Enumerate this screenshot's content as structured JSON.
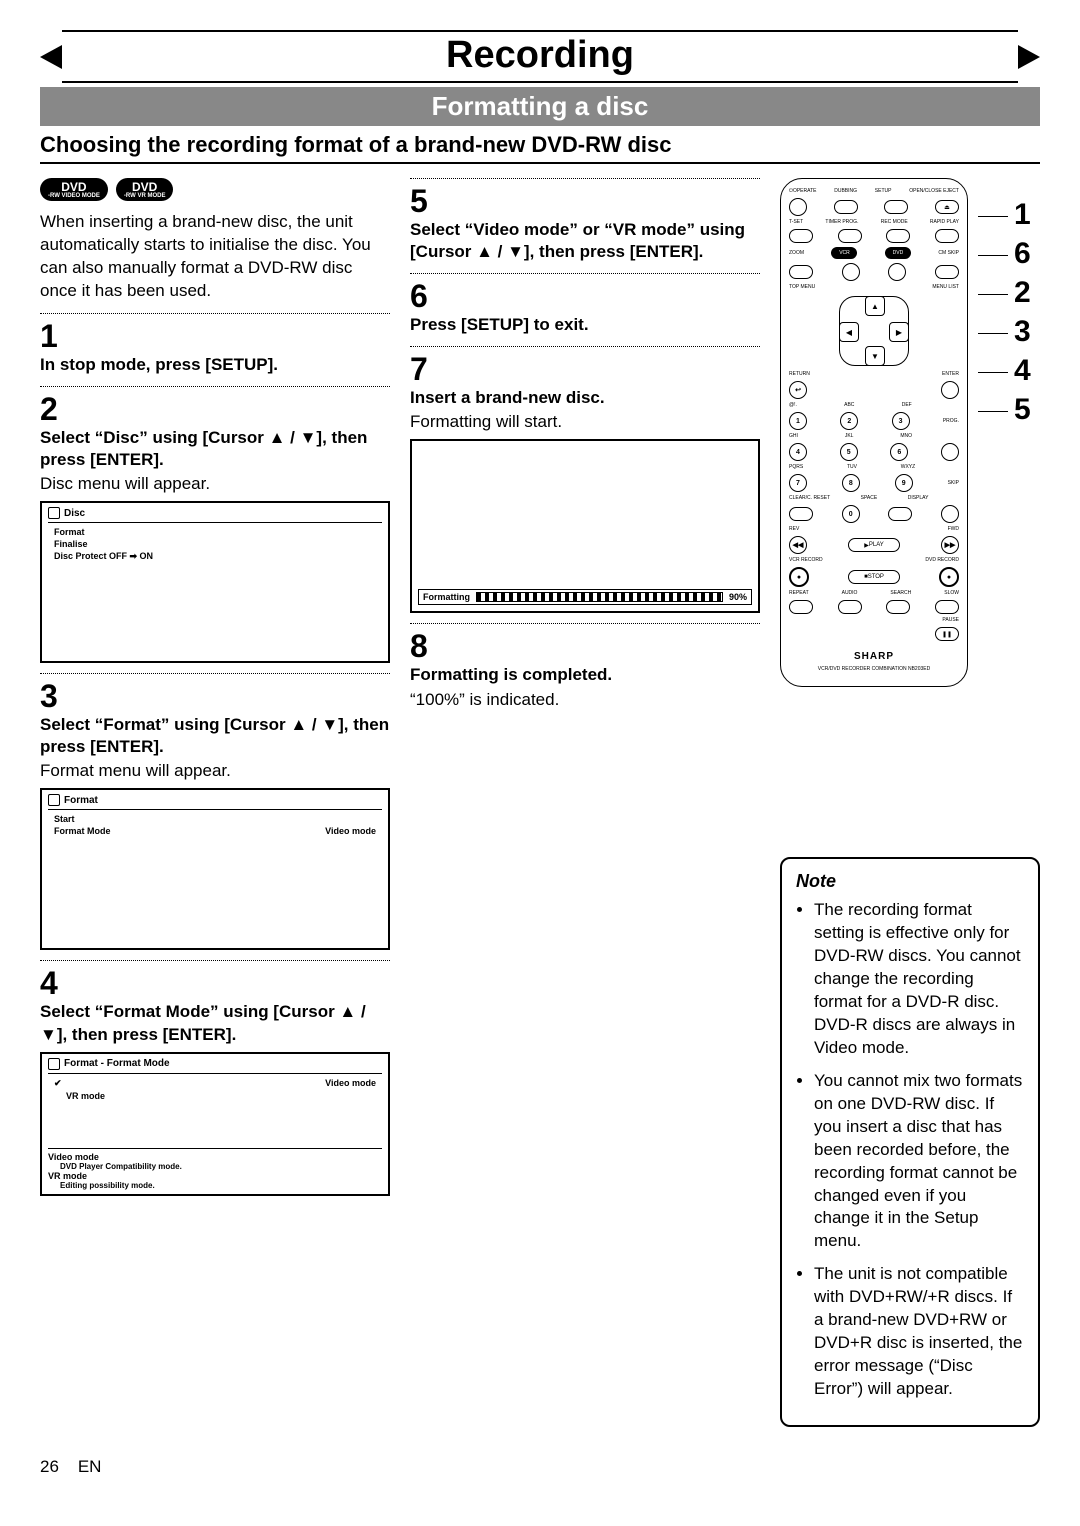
{
  "header": {
    "title": "Recording",
    "subtitle": "Formatting a disc",
    "section": "Choosing the recording format of a brand-new DVD-RW disc"
  },
  "badges": {
    "a": "DVD",
    "a_sub": "-RW VIDEO MODE",
    "b": "DVD",
    "b_sub": "-RW VR MODE"
  },
  "intro": "When inserting a brand-new disc, the unit automatically starts to initialise the disc. You can also manually format a DVD-RW disc once it has been used.",
  "step1": {
    "num": "1",
    "bold": "In stop mode, press [SETUP]."
  },
  "step2": {
    "num": "2",
    "bold": "Select “Disc” using [Cursor ▲ / ▼], then press [ENTER].",
    "plain": "Disc menu will appear.",
    "screen": {
      "title": "Disc",
      "rows": [
        "Format",
        "Finalise",
        "Disc Protect OFF ➡ ON"
      ]
    }
  },
  "step3": {
    "num": "3",
    "bold": "Select “Format” using [Cursor ▲ / ▼], then press [ENTER].",
    "plain": "Format menu will appear.",
    "screen": {
      "title": "Format",
      "rows": [
        [
          "Start",
          ""
        ],
        [
          "Format Mode",
          "Video mode"
        ]
      ]
    }
  },
  "step4": {
    "num": "4",
    "bold": "Select “Format Mode” using [Cursor ▲ / ▼], then press [ENTER].",
    "screen": {
      "title": "Format - Format Mode",
      "rows": [
        "Video mode",
        "VR mode"
      ],
      "hints": [
        [
          "Video mode",
          "DVD Player Compatibility mode."
        ],
        [
          "VR mode",
          "Editing possibility mode."
        ]
      ]
    }
  },
  "step5": {
    "num": "5",
    "bold": "Select “Video mode” or “VR mode” using [Cursor ▲ / ▼], then press [ENTER]."
  },
  "step6": {
    "num": "6",
    "bold": "Press [SETUP] to exit."
  },
  "step7": {
    "num": "7",
    "bold": "Insert a brand-new disc.",
    "plain": "Formatting will start.",
    "screen": {
      "label": "Formatting",
      "pct": "90%"
    }
  },
  "step8": {
    "num": "8",
    "bold": "Formatting is completed.",
    "plain": "“100%” is indicated."
  },
  "remote": {
    "top_labels": [
      "⏻OPERATE",
      "DUBBING",
      "SETUP",
      "OPEN/CLOSE EJECT"
    ],
    "row2": [
      "T-SET",
      "TIMER PROG.",
      "REC MODE",
      "RAPID PLAY"
    ],
    "row3": [
      "ZOOM",
      "VCR",
      "DVD",
      "CM SKIP"
    ],
    "row4": [
      "TOP MENU",
      "",
      "",
      "MENU LIST"
    ],
    "side": [
      "RETURN",
      "ENTER"
    ],
    "num_lbls": [
      "@!.",
      "ABC",
      "DEF",
      "GHI",
      "JKL",
      "MNO",
      "PQRS",
      "TUV",
      "WXYZ"
    ],
    "nums": [
      "1",
      "2",
      "3",
      "4",
      "5",
      "6",
      "7",
      "8",
      "9",
      "0"
    ],
    "extra": [
      "PROG.",
      "SKIP",
      "CLEAR/C. RESET",
      "SPACE",
      "DISPLAY"
    ],
    "transport": [
      "REV",
      "FWD",
      "PLAY",
      "STOP",
      "VCR RECORD",
      "DVD RECORD"
    ],
    "bottom": [
      "REPEAT",
      "AUDIO",
      "SEARCH",
      "SLOW",
      "PAUSE"
    ],
    "brand": "SHARP",
    "model": "VCR/DVD RECORDER COMBINATION NB203ED"
  },
  "callouts": [
    "1",
    "6",
    "2",
    "3",
    "4",
    "5"
  ],
  "note": {
    "title": "Note",
    "items": [
      "The recording format setting is effective only for DVD-RW discs. You cannot change the recording format for a DVD-R disc. DVD-R discs are always in Video mode.",
      "You cannot mix two formats on one DVD-RW disc. If you insert a disc that has been recorded before, the recording format cannot be changed even if you change it in the Setup menu.",
      "The unit is not compatible with DVD+RW/+R discs. If a brand-new DVD+RW or DVD+R disc is inserted, the error message (“Disc Error”) will appear."
    ]
  },
  "footer": {
    "page": "26",
    "lang": "EN"
  }
}
